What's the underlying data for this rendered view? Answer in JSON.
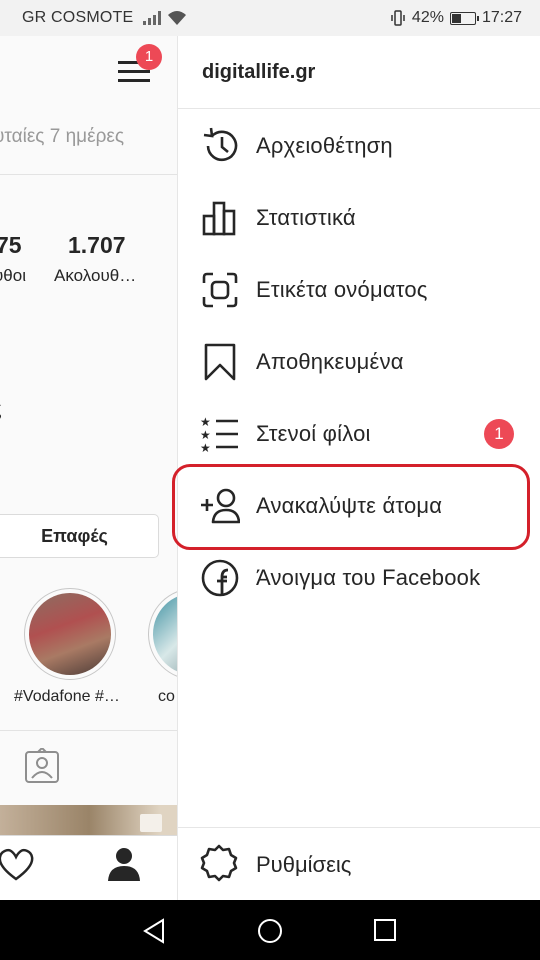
{
  "status_bar": {
    "carrier": "GR COSMOTE",
    "battery": "42%",
    "battery_level": 0.42,
    "time": "17:27"
  },
  "profile_bg": {
    "menu_badge": "1",
    "days_text": "υταίες 7 ημέρες",
    "stat1_value": "75",
    "stat1_label": "υθοι",
    "stat2_value": "1.707",
    "stat2_label": "Ακολουθ…",
    "fragment": "ς",
    "contacts_button": "Επαφές",
    "stories": [
      "#Vodafone #…",
      "co"
    ]
  },
  "drawer": {
    "username": "digitallife.gr",
    "items": [
      {
        "label": "Αρχειοθέτηση",
        "icon": "archive-history-icon"
      },
      {
        "label": "Στατιστικά",
        "icon": "bar-chart-icon"
      },
      {
        "label": "Ετικέτα ονόματος",
        "icon": "nametag-scan-icon"
      },
      {
        "label": "Αποθηκευμένα",
        "icon": "bookmark-icon"
      },
      {
        "label": "Στενοί φίλοι",
        "icon": "close-friends-list-icon",
        "badge": "1"
      },
      {
        "label": "Ανακαλύψτε άτομα",
        "icon": "add-person-icon"
      },
      {
        "label": "Άνοιγμα του Facebook",
        "icon": "facebook-icon"
      }
    ],
    "settings_label": "Ρυθμίσεις"
  },
  "colors": {
    "badge": "#ed4956",
    "highlight": "#d4202a"
  }
}
